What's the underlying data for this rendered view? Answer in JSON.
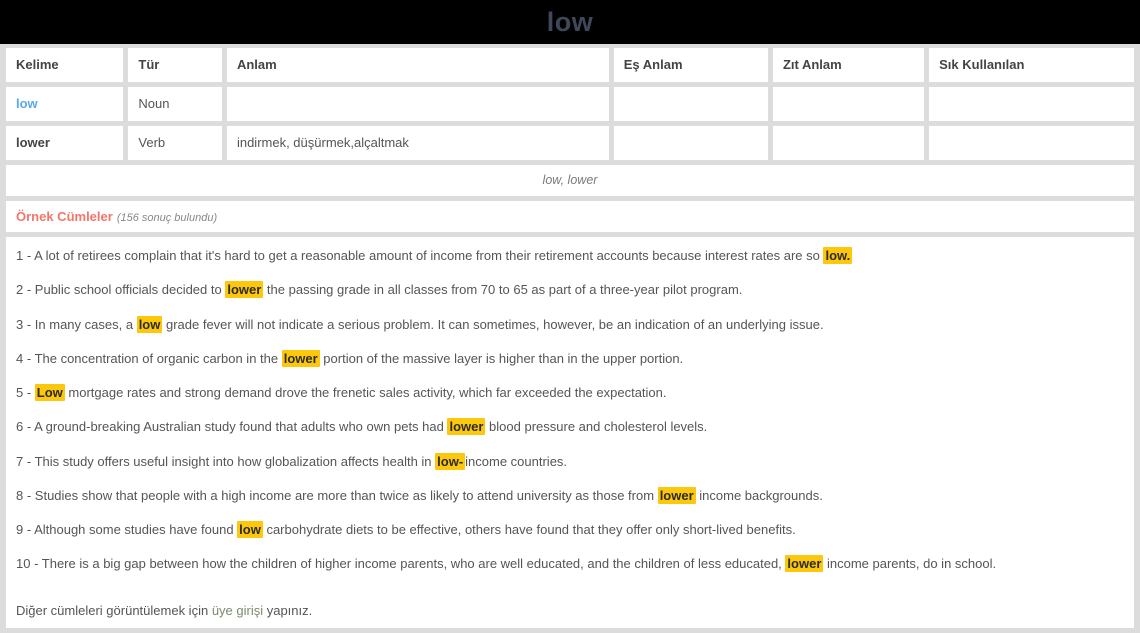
{
  "header": {
    "title": "low"
  },
  "table": {
    "columns": [
      "Kelime",
      "Tür",
      "Anlam",
      "Eş Anlam",
      "Zıt Anlam",
      "Sık Kullanılan"
    ],
    "rows": [
      {
        "kelime": "low",
        "tur": "Noun",
        "anlam": "",
        "es_anlam": "",
        "zit_anlam": "",
        "sik_kullanilan": ""
      },
      {
        "kelime": "lower",
        "tur": "Verb",
        "anlam": "indirmek, düşürmek,alçaltmak",
        "es_anlam": "",
        "zit_anlam": "",
        "sik_kullanilan": ""
      }
    ]
  },
  "forms_row": {
    "text": "low, lower"
  },
  "examples": {
    "title": "Örnek Cümleler",
    "count_text": "(156 sonuç bulundu)",
    "sentences": [
      {
        "num": "1 - ",
        "parts": [
          {
            "t": "A lot of retirees complain that it's hard to get a reasonable amount of income from their retirement accounts because interest rates are so ",
            "h": false
          },
          {
            "t": "low.",
            "h": true
          }
        ]
      },
      {
        "num": "2 - ",
        "parts": [
          {
            "t": "Public school officials decided to ",
            "h": false
          },
          {
            "t": "lower",
            "h": true
          },
          {
            "t": " the passing grade in all classes from 70 to 65 as part of a three-year pilot program.",
            "h": false
          }
        ]
      },
      {
        "num": "3 - ",
        "parts": [
          {
            "t": "In many cases, a ",
            "h": false
          },
          {
            "t": "low",
            "h": true
          },
          {
            "t": " grade fever will not indicate a serious problem. It can sometimes, however, be an indication of an underlying issue.",
            "h": false
          }
        ]
      },
      {
        "num": "4 - ",
        "parts": [
          {
            "t": "The concentration of organic carbon in the ",
            "h": false
          },
          {
            "t": "lower",
            "h": true
          },
          {
            "t": " portion of the massive layer is higher than in the upper portion.",
            "h": false
          }
        ]
      },
      {
        "num": "5 - ",
        "parts": [
          {
            "t": "Low",
            "h": true
          },
          {
            "t": " mortgage rates and strong demand drove the frenetic sales activity, which far exceeded the expectation.",
            "h": false
          }
        ]
      },
      {
        "num": "6 - ",
        "parts": [
          {
            "t": "A ground-breaking Australian study found that adults who own pets had ",
            "h": false
          },
          {
            "t": "lower",
            "h": true
          },
          {
            "t": " blood pressure and cholesterol levels.",
            "h": false
          }
        ]
      },
      {
        "num": "7 - ",
        "parts": [
          {
            "t": "This study offers useful insight into how globalization affects health in ",
            "h": false
          },
          {
            "t": "low-",
            "h": true
          },
          {
            "t": "income countries.",
            "h": false
          }
        ]
      },
      {
        "num": "8 - ",
        "parts": [
          {
            "t": "Studies show that people with a high income are more than twice as likely to attend university as those from ",
            "h": false
          },
          {
            "t": "lower",
            "h": true
          },
          {
            "t": " income backgrounds.",
            "h": false
          }
        ]
      },
      {
        "num": "9 - ",
        "parts": [
          {
            "t": "Although some studies have found ",
            "h": false
          },
          {
            "t": "low",
            "h": true
          },
          {
            "t": " carbohydrate diets to be effective, others have found that they offer only short-lived benefits.",
            "h": false
          }
        ]
      },
      {
        "num": "10 - ",
        "parts": [
          {
            "t": "There is a big gap between how the children of higher income parents, who are well educated, and the children of less educated, ",
            "h": false
          },
          {
            "t": "lower",
            "h": true
          },
          {
            "t": " income parents, do in school.",
            "h": false
          }
        ]
      }
    ],
    "footer": {
      "before": "Diğer cümleleri görüntülemek için ",
      "link": "üye girişi",
      "after": " yapınız."
    }
  },
  "colors": {
    "header_bg": "#000000",
    "header_text": "#3f4759",
    "highlight": "#fdc70c",
    "examples_title": "#f4766a",
    "word_link": "#5ba8e8",
    "panel_bg": "#dcdcdc"
  }
}
